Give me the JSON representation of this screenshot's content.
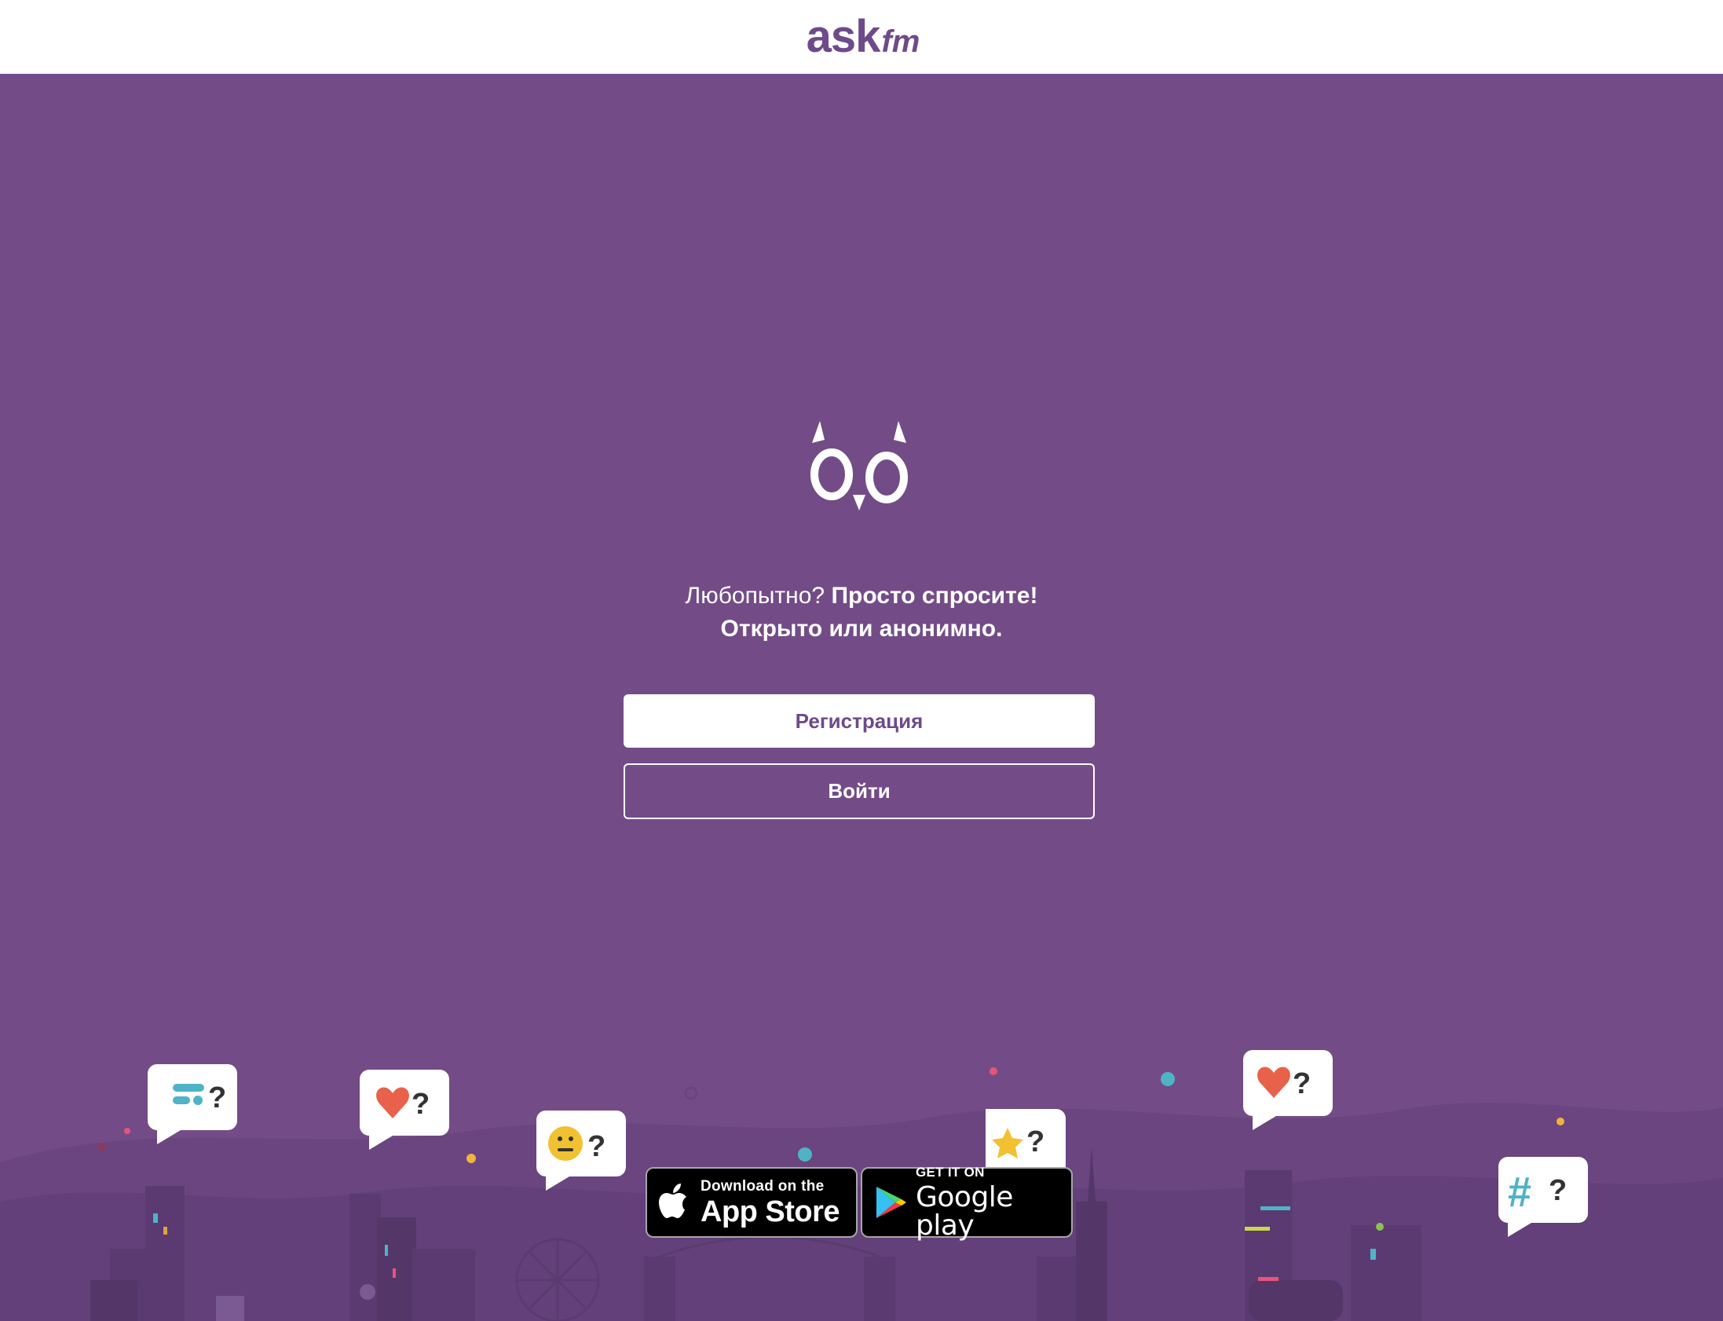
{
  "header": {
    "logo_ask": "ask",
    "logo_fm": "fm"
  },
  "hero": {
    "tagline_light": "Любопытно?",
    "tagline_bold": "Просто спросите!",
    "tagline_line2": "Открыто или анонимно."
  },
  "actions": {
    "register_label": "Регистрация",
    "login_label": "Войти"
  },
  "store_badges": {
    "apple_small": "Download on the",
    "apple_big": "App Store",
    "google_small": "GET IT ON",
    "google_big": "Google play"
  },
  "colors": {
    "brand_purple": "#734c87",
    "logo_purple": "#6e4a8a",
    "white": "#ffffff"
  },
  "icons": [
    "owl-eyes-icon",
    "apple-icon",
    "google-play-icon",
    "chat-bubble-icon",
    "heart-icon",
    "star-icon",
    "smiley-icon",
    "hashtag-icon"
  ]
}
